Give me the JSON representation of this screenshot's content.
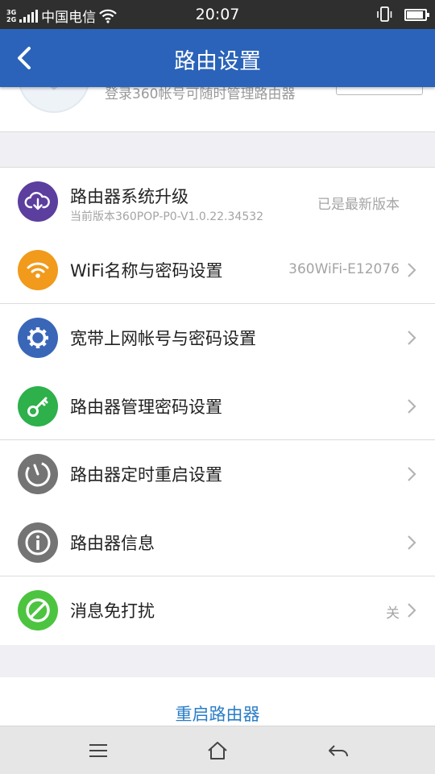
{
  "status_bar": {
    "network_top": "3G",
    "network_bottom": "2G",
    "carrier": "中国电信",
    "time": "20:07",
    "icons": [
      "signal-icon",
      "wifi-icon",
      "vibrate-icon",
      "battery-icon"
    ]
  },
  "header": {
    "title": "路由设置",
    "back_icon": "chevron-left-icon"
  },
  "login_card": {
    "text": "登录360帐号可随时管理路由器"
  },
  "settings": [
    {
      "label": "路由器系统升级",
      "sub": "当前版本360POP-P0-V1.0.22.34532",
      "value": "已是最新版本",
      "icon": "cloud-download-icon",
      "color": "#5b3e9e",
      "chevron": false
    },
    {
      "label": "WiFi名称与密码设置",
      "value": "360WiFi-E12076",
      "icon": "wifi-icon",
      "color": "#f19a1b",
      "chevron": true
    },
    {
      "label": "宽带上网帐号与密码设置",
      "value": "",
      "icon": "gear-icon",
      "color": "#3a66b8",
      "chevron": true
    },
    {
      "label": "路由器管理密码设置",
      "value": "",
      "icon": "key-icon",
      "color": "#2eb04b",
      "chevron": true
    },
    {
      "label": "路由器定时重启设置",
      "value": "",
      "icon": "power-timer-icon",
      "color": "#747474",
      "chevron": true
    },
    {
      "label": "路由器信息",
      "value": "",
      "icon": "info-icon",
      "color": "#747474",
      "chevron": true
    },
    {
      "label": "消息免打扰",
      "value": "关",
      "icon": "do-not-disturb-icon",
      "color": "#4cc43f",
      "chevron": true
    }
  ],
  "restart_label": "重启路由器",
  "nav": [
    "menu-icon",
    "home-icon",
    "back-icon"
  ]
}
